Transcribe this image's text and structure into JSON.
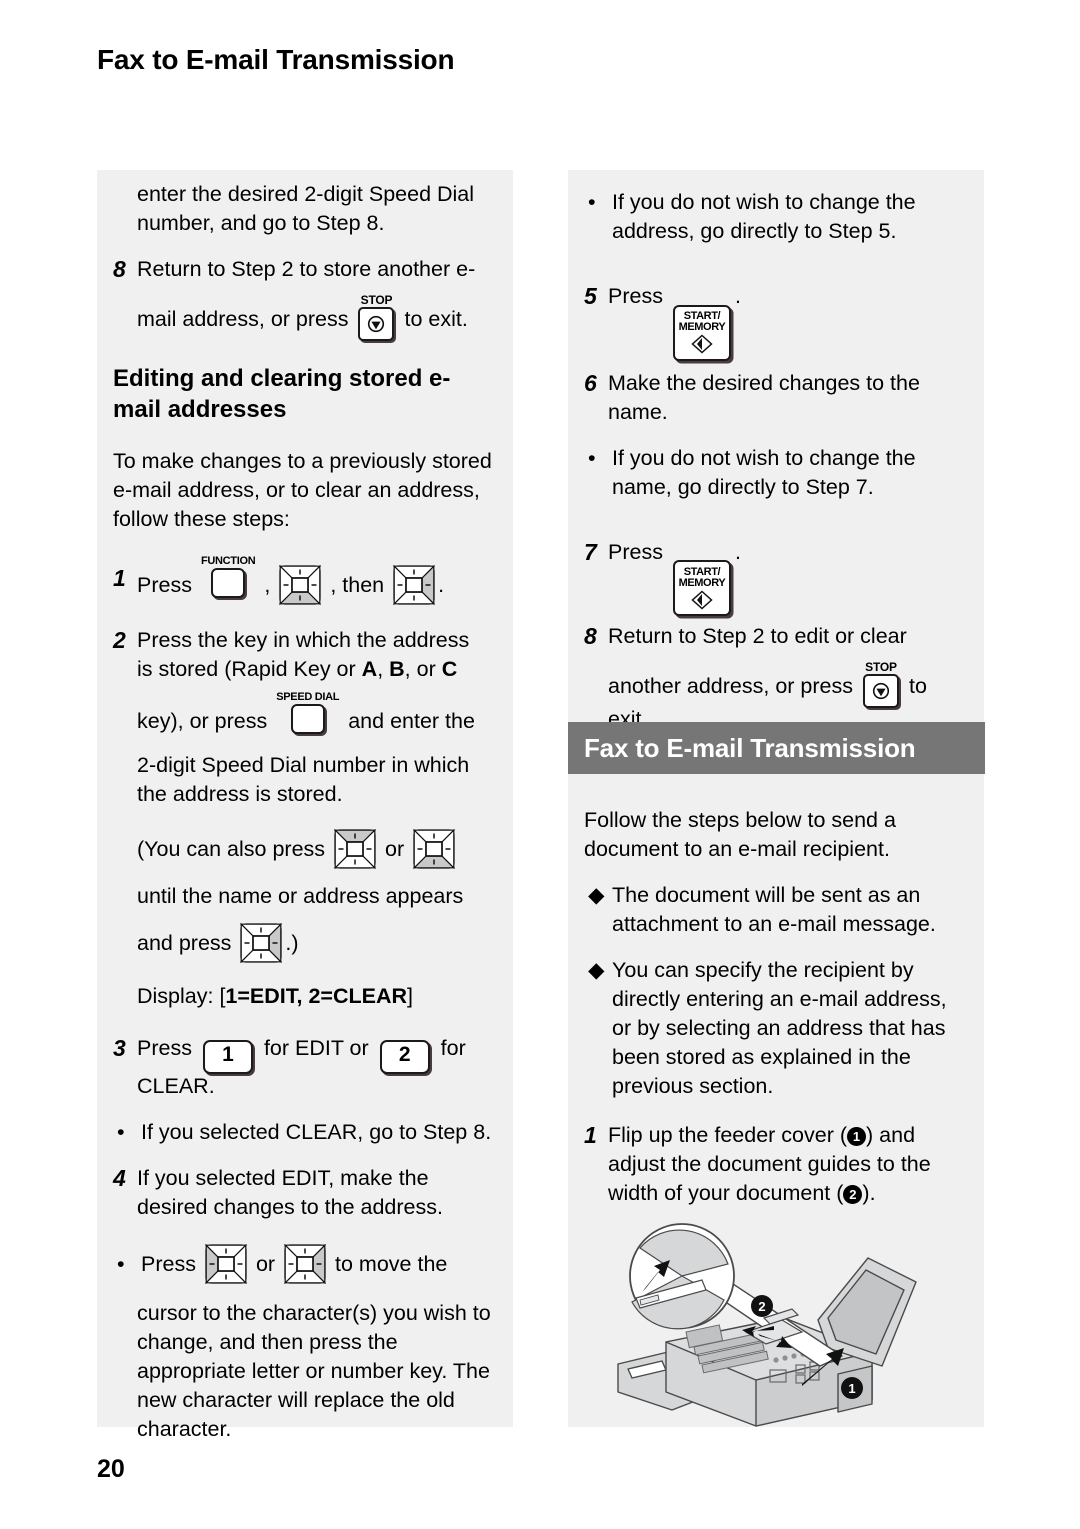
{
  "page": {
    "title": "Fax to E-mail Transmission",
    "number": "20"
  },
  "colors": {
    "panel_bg": "#f0f0f0",
    "banner_bg": "#767676",
    "banner_text": "#ffffff",
    "key_shadow": "#4a3c3c",
    "key_shade": "#c9c9c9"
  },
  "left_column": {
    "cont_step7": "enter the desired 2-digit Speed Dial number, and go to Step 8.",
    "step8": {
      "num": "8",
      "line1": "Return to Step 2 to store another e-",
      "line2_pre": "mail address, or press",
      "line2_post": "to exit.",
      "key": {
        "caption": "STOP",
        "name": "stop-key"
      }
    },
    "subheading": "Editing and clearing stored e-mail addresses",
    "intro": "To make changes to a previously stored e-mail address, or to clear an address, follow these steps:",
    "step1": {
      "num": "1",
      "press": "Press",
      "key1": {
        "caption": "FUNCTION",
        "name": "function-key"
      },
      "sep1": ",",
      "key2": {
        "direction": "down",
        "name": "down-arrow-key"
      },
      "sep2": ", then",
      "key3": {
        "direction": "right",
        "name": "right-arrow-key"
      },
      "end": "."
    },
    "step2": {
      "num": "2",
      "line1": "Press the key in which the address",
      "line2a": "is stored (Rapid Key or ",
      "line2b_A": "A",
      "line2c": ", ",
      "line2b_B": "B",
      "line2d": ", or ",
      "line2b_C": "C",
      "line3_pre": "key), or press",
      "speed_dial_key": {
        "caption": "SPEED DIAL",
        "name": "speed-dial-key"
      },
      "line3_post": "and enter the",
      "line4": "2-digit Speed Dial number in which the address is stored.",
      "paren1_pre": "(You can also press",
      "paren_key1": {
        "direction": "up",
        "name": "up-arrow-key"
      },
      "paren_or": "or",
      "paren_key2": {
        "direction": "down",
        "name": "down-arrow-key"
      },
      "paren2": "until the name or address appears",
      "paren3_pre": "and press",
      "paren_key3": {
        "direction": "right",
        "name": "right-arrow-key"
      },
      "paren3_post": ".)",
      "display_label": "Display: [",
      "display_value": "1=EDIT, 2=CLEAR",
      "display_close": "]"
    },
    "step3": {
      "num": "3",
      "press": "Press",
      "key1": "1",
      "mid": "for EDIT or",
      "key2": "2",
      "post": "for",
      "line2": "CLEAR."
    },
    "bullet_clear": "If you selected CLEAR, go to Step 8.",
    "step4": {
      "num": "4",
      "text": "If you selected EDIT, make the desired changes to the address."
    },
    "bullet_press": {
      "pre": "Press",
      "key1": {
        "direction": "left",
        "name": "left-arrow-key"
      },
      "or": "or",
      "key2": {
        "direction": "right",
        "name": "right-arrow-key"
      },
      "post": "to move the",
      "rest": "cursor to the character(s) you wish to change, and then press the appropriate letter or number key. The new character will replace the old character."
    }
  },
  "right_column": {
    "bullet_address": "If you do not wish to change the address, go directly to Step 5.",
    "step5": {
      "num": "5",
      "press": "Press",
      "key": {
        "line1": "START/",
        "line2": "MEMORY",
        "name": "start-memory-key"
      },
      "end": "."
    },
    "step6": {
      "num": "6",
      "text": "Make the desired changes to the name."
    },
    "bullet_name": "If you do not wish to change the name, go directly to Step 7.",
    "step7": {
      "num": "7",
      "press": "Press",
      "key": {
        "line1": "START/",
        "line2": "MEMORY",
        "name": "start-memory-key"
      },
      "end": "."
    },
    "step8": {
      "num": "8",
      "line1": "Return to Step 2 to edit or clear",
      "line2_pre": "another address, or press",
      "key": {
        "caption": "STOP",
        "name": "stop-key"
      },
      "line2_post": "to",
      "line3": "exit."
    },
    "banner_title": "Fax to E-mail Transmission",
    "intro": "Follow the steps below to send a document to an e-mail recipient.",
    "diamond_bullet_1": "The document will be sent as an attachment to an e-mail message.",
    "diamond_bullet_2": "You can specify the recipient by directly entering an e-mail address, or by selecting an address that has been stored as explained in the previous section.",
    "step1": {
      "num": "1",
      "part1": "Flip up the feeder cover (",
      "marker1": "1",
      "part2": ") and adjust the document guides to the width of your document (",
      "marker2": "2",
      "part3": ")."
    },
    "illustration": {
      "name": "fax-machine-illustration",
      "marker1": "1",
      "marker2": "2"
    }
  }
}
